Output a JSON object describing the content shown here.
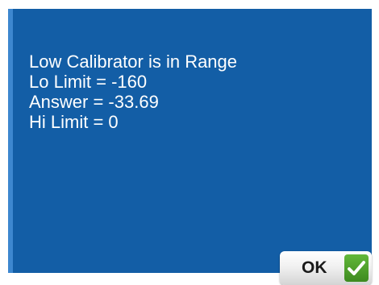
{
  "dialog": {
    "lines": [
      "Low Calibrator is in Range",
      "Lo Limit = -160",
      "Answer = -33.69",
      "Hi Limit = 0"
    ],
    "ok_label": "OK",
    "ok_icon": "checkmark-icon",
    "colors": {
      "background": "#135ea6",
      "accent_border": "#3d87cf",
      "text": "#ffffff",
      "check_green": "#4fa32c"
    }
  }
}
